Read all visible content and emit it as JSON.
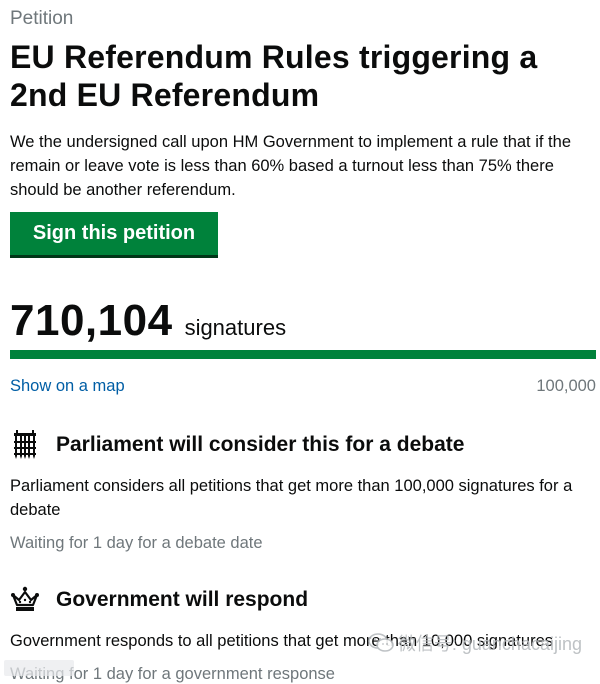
{
  "petition": {
    "kicker": "Petition",
    "title": "EU Referendum Rules triggering a 2nd EU Referendum",
    "description": "We the undersigned call upon HM Government to implement a rule that if the remain or leave vote is less than 60% based a turnout less than 75% there should be another referendum.",
    "sign_button": "Sign this petition"
  },
  "signatures": {
    "count": "710,104",
    "label": "signatures",
    "map_link": "Show on a map",
    "threshold": "100,000",
    "progress_fraction": 1.0,
    "progress_color": "#00823b"
  },
  "steps": [
    {
      "icon": "portcullis-icon",
      "title": "Parliament will consider this for a debate",
      "body": "Parliament considers all petitions that get more than 100,000 signatures for a debate",
      "status": "Waiting for 1 day for a debate date"
    },
    {
      "icon": "crown-icon",
      "title": "Government will respond",
      "body": "Government responds to all petitions that get more than 10,000 signatures",
      "status": "Waiting for 1 day for a government response"
    }
  ],
  "watermark": {
    "icon": "wechat-icon",
    "text": "微信号: guanchacaijing"
  },
  "colors": {
    "accent_green": "#00823b",
    "link_blue": "#005ea5",
    "muted_grey": "#6f777b"
  }
}
